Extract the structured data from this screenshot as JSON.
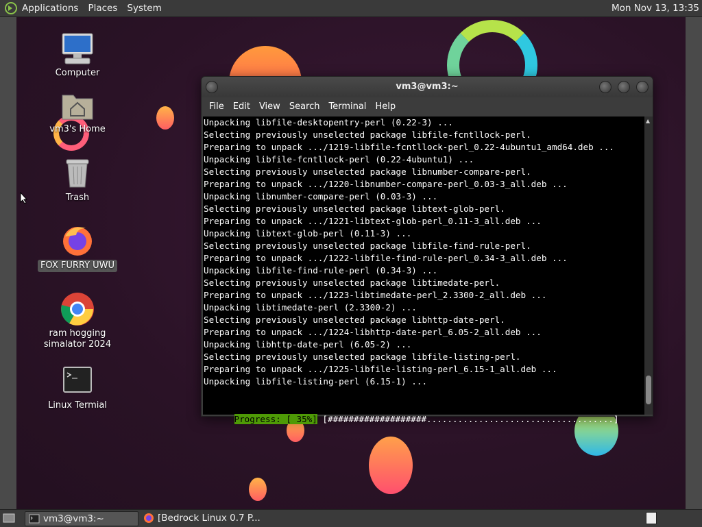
{
  "top_panel": {
    "menus": [
      "Applications",
      "Places",
      "System"
    ],
    "clock": "Mon Nov 13, 13:35"
  },
  "desktop_icons": [
    {
      "label": "Computer",
      "icon": "computer-icon"
    },
    {
      "label": "vm3's Home",
      "icon": "home-folder-icon"
    },
    {
      "label": "Trash",
      "icon": "trash-icon"
    },
    {
      "label": "FOX FURRY UWU",
      "icon": "firefox-icon"
    },
    {
      "label": "ram hogging\nsimalator 2024",
      "icon": "chrome-icon"
    },
    {
      "label": "Linux Termial",
      "icon": "terminal-icon"
    }
  ],
  "terminal": {
    "title": "vm3@vm3:~",
    "menu": [
      "File",
      "Edit",
      "View",
      "Search",
      "Terminal",
      "Help"
    ],
    "lines": [
      "Unpacking libfile-desktopentry-perl (0.22-3) ...",
      "Selecting previously unselected package libfile-fcntllock-perl.",
      "Preparing to unpack .../1219-libfile-fcntllock-perl_0.22-4ubuntu1_amd64.deb ...",
      "Unpacking libfile-fcntllock-perl (0.22-4ubuntu1) ...",
      "Selecting previously unselected package libnumber-compare-perl.",
      "Preparing to unpack .../1220-libnumber-compare-perl_0.03-3_all.deb ...",
      "Unpacking libnumber-compare-perl (0.03-3) ...",
      "Selecting previously unselected package libtext-glob-perl.",
      "Preparing to unpack .../1221-libtext-glob-perl_0.11-3_all.deb ...",
      "Unpacking libtext-glob-perl (0.11-3) ...",
      "Selecting previously unselected package libfile-find-rule-perl.",
      "Preparing to unpack .../1222-libfile-find-rule-perl_0.34-3_all.deb ...",
      "Unpacking libfile-find-rule-perl (0.34-3) ...",
      "Selecting previously unselected package libtimedate-perl.",
      "Preparing to unpack .../1223-libtimedate-perl_2.3300-2_all.deb ...",
      "Unpacking libtimedate-perl (2.3300-2) ...",
      "Selecting previously unselected package libhttp-date-perl.",
      "Preparing to unpack .../1224-libhttp-date-perl_6.05-2_all.deb ...",
      "Unpacking libhttp-date-perl (6.05-2) ...",
      "Selecting previously unselected package libfile-listing-perl.",
      "Preparing to unpack .../1225-libfile-listing-perl_6.15-1_all.deb ...",
      "Unpacking libfile-listing-perl (6.15-1) ..."
    ],
    "progress_label": "Progress: [ 35%]",
    "progress_bar": " [###################....................................]"
  },
  "taskbar": {
    "tasks": [
      {
        "label": "vm3@vm3:~",
        "icon": "terminal-icon",
        "active": true
      },
      {
        "label": "[Bedrock Linux 0.7 P...",
        "icon": "firefox-icon",
        "active": false
      }
    ]
  },
  "colors": {
    "progress_green": "#4e9a06",
    "panel": "#3a3a3a"
  }
}
